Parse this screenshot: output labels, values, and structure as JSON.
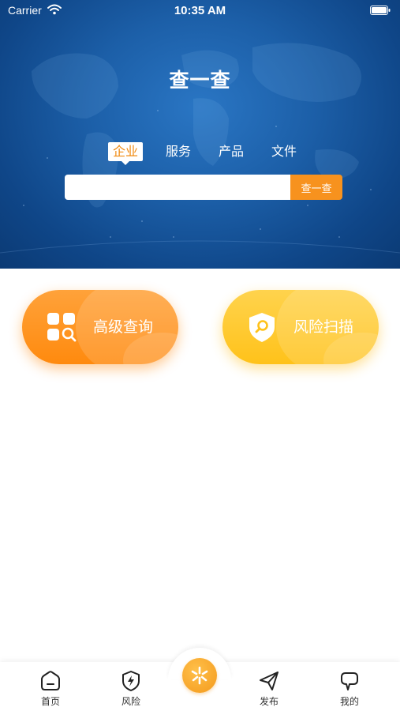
{
  "status_bar": {
    "carrier": "Carrier",
    "time": "10:35 AM"
  },
  "header": {
    "title": "查一查"
  },
  "search": {
    "tabs": [
      {
        "label": "企业",
        "active": true
      },
      {
        "label": "服务",
        "active": false
      },
      {
        "label": "产品",
        "active": false
      },
      {
        "label": "文件",
        "active": false
      }
    ],
    "input_value": "",
    "placeholder": "",
    "button_label": "查一查"
  },
  "actions": [
    {
      "label": "高级查询",
      "icon": "grid-search-icon",
      "color": "#ff8a0e"
    },
    {
      "label": "风险扫描",
      "icon": "shield-search-icon",
      "color": "#ffc21a"
    }
  ],
  "tabbar": {
    "items": [
      {
        "label": "首页",
        "icon": "home-icon"
      },
      {
        "label": "风险",
        "icon": "shield-lightning-icon"
      },
      {
        "label": "发布",
        "icon": "send-icon"
      },
      {
        "label": "我的",
        "icon": "chat-bubble-icon"
      }
    ],
    "center_icon": "spark-icon"
  },
  "colors": {
    "accent": "#f7921e",
    "hero_blue": "#1c5fa8",
    "risk_yellow": "#ffc21a"
  }
}
